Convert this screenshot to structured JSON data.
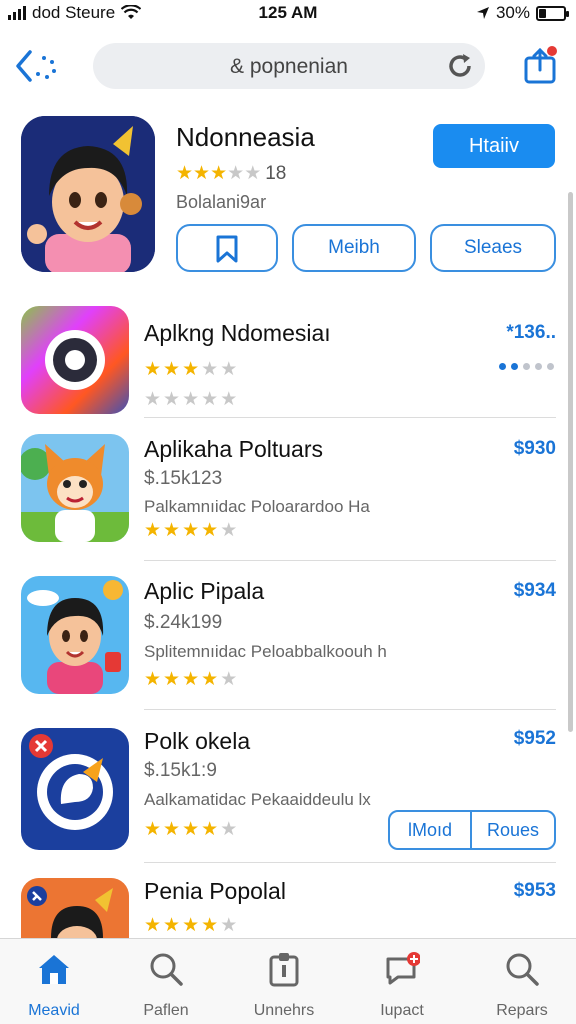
{
  "status_bar": {
    "carrier": "dod Steure",
    "time": "125 AM",
    "battery": "30%",
    "battery_level": 0.3
  },
  "nav": {
    "search_query": "& popnenian"
  },
  "featured": {
    "title": "Ndonneasia",
    "rating_count": "18",
    "rating": 3,
    "subtitle": "Bolalani9ar",
    "primary_button": "Htaiiv",
    "buttons": [
      "Meibh",
      "Sleaes"
    ]
  },
  "list": [
    {
      "name": "Aplkng Ndomesiaı",
      "price": "*136..",
      "rating": 3,
      "rating2": 0
    },
    {
      "name": "Aplikaha Poltuars",
      "price": "$930",
      "meta": "$.15k123",
      "desc": "Palkamnıidac Poloarardoo Ha",
      "rating": 4
    },
    {
      "name": "Aplic Pipala",
      "price": "$934",
      "meta": "$.24k199",
      "desc": "Splitemnıidac Peloabbalkoouh h",
      "rating": 4
    },
    {
      "name": "Polk okela",
      "price": "$952",
      "meta": "$.15k1:9",
      "desc": "Aalkamatidac Pekaaiddeulu lx",
      "rating": 4,
      "buttons": [
        "lMoıd",
        "Roues"
      ]
    },
    {
      "name": "Penia Popolal",
      "price": "$953",
      "rating": 4
    }
  ],
  "tabs": [
    {
      "label": "Meavid",
      "icon": "home-icon",
      "active": true
    },
    {
      "label": "Paflen",
      "icon": "search-icon",
      "active": false
    },
    {
      "label": "Unnehrs",
      "icon": "apps-icon",
      "active": false
    },
    {
      "label": "Iupact",
      "icon": "updates-icon",
      "active": false
    },
    {
      "label": "Repars",
      "icon": "search-icon",
      "active": false
    }
  ],
  "colors": {
    "accent": "#1a74d6",
    "button_fill": "#1a8cf0",
    "star": "#f4b400"
  }
}
